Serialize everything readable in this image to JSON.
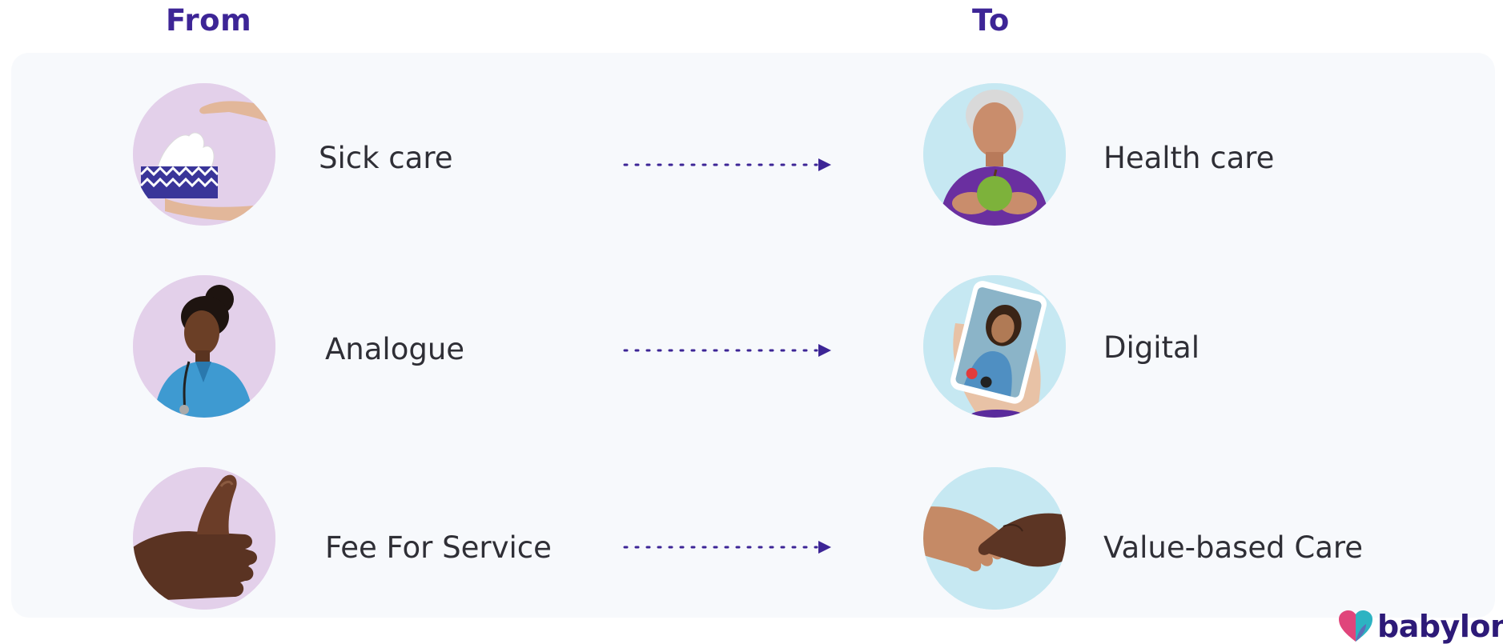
{
  "headings": {
    "from": "From",
    "to": "To"
  },
  "rows": [
    {
      "from_label": "Sick care",
      "to_label": "Health care",
      "from_image": "tissue-box-icon",
      "to_image": "woman-holding-apple-icon"
    },
    {
      "from_label": "Analogue",
      "to_label": "Digital",
      "from_image": "nurse-with-stethoscope-icon",
      "to_image": "video-call-phone-icon"
    },
    {
      "from_label": "Fee For Service",
      "to_label": "Value-based Care",
      "from_image": "thumbs-up-icon",
      "to_image": "handshake-icon"
    }
  ],
  "logo": {
    "text": "babylon",
    "icon": "heart-logo-icon"
  },
  "colors": {
    "heading": "#3d2596",
    "arrow": "#3d2596",
    "from_circle": "#e3d0ea",
    "to_circle": "#c6e8f2",
    "panel": "#f7f9fc",
    "label_text": "#2f2f36",
    "logo_heart_left": "#e0457b",
    "logo_heart_right": "#2db3c2"
  }
}
